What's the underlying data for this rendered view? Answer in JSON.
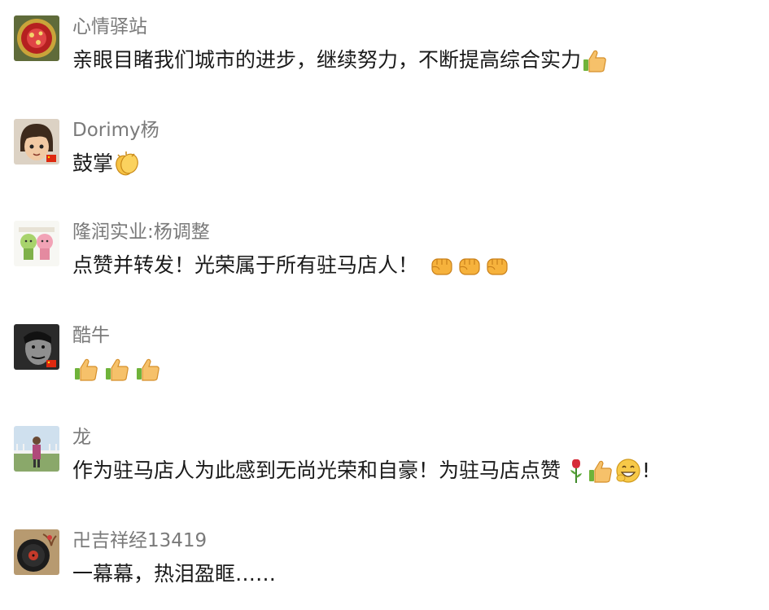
{
  "comments": [
    {
      "username": "心情驿站",
      "text": "亲眼目睹我们城市的进步，继续努力，不断提高综合实力",
      "emojis": [
        "thumbs-up"
      ]
    },
    {
      "username": "Dorimy杨",
      "text": "鼓掌",
      "emojis": [
        "clapping-hands"
      ]
    },
    {
      "username": "隆润实业:杨调整",
      "text": "点赞并转发！光荣属于所有驻马店人！",
      "emojis": [
        "fist",
        "fist",
        "fist"
      ]
    },
    {
      "username": "酷牛",
      "text": "",
      "emojis": [
        "thumbs-up",
        "thumbs-up",
        "thumbs-up"
      ]
    },
    {
      "username": "龙",
      "text": "作为驻马店人为此感到无尚光荣和自豪！为驻马店点赞",
      "emojis": [
        "rose",
        "thumbs-up",
        "grinning-face"
      ],
      "suffix": "!"
    },
    {
      "username": "卍吉祥经13419",
      "text": "一幕幕，热泪盈眶……",
      "emojis": []
    }
  ]
}
